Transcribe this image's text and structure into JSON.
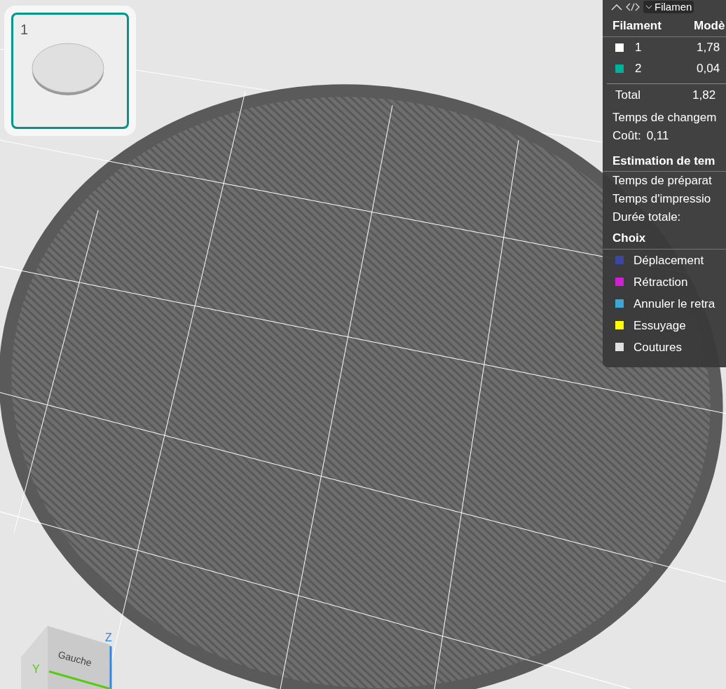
{
  "thumbnail": {
    "label": "1",
    "selected": true
  },
  "panel": {
    "toolbar_label": "Filamen",
    "columns": [
      "Filament",
      "Modè"
    ],
    "rows": [
      {
        "label": "1",
        "color": "#ffffff",
        "value": "1,78"
      },
      {
        "label": "2",
        "color": "#00b09a",
        "value": "0,04"
      }
    ],
    "total": {
      "label": "Total",
      "value": "1,82"
    },
    "change_time": "Temps de changem",
    "cost": {
      "label": "Coût:",
      "value": "0,11"
    },
    "time_section": {
      "title": "Estimation de tem",
      "lines": [
        "Temps de préparat",
        "Temps d'impressio",
        "Durée totale:"
      ]
    },
    "legend": {
      "title": "Choix",
      "items": [
        {
          "label": "Déplacement",
          "color": "#3b48a0"
        },
        {
          "label": "Rétraction",
          "color": "#d21fd4"
        },
        {
          "label": "Annuler le retra",
          "color": "#3aa8d2"
        },
        {
          "label": "Essuyage",
          "color": "#ffff00"
        },
        {
          "label": "Coutures",
          "color": "#e0e0e0"
        }
      ]
    }
  },
  "view_cube": {
    "face_label": "Gauche",
    "axes": [
      "Z",
      "Y"
    ]
  }
}
